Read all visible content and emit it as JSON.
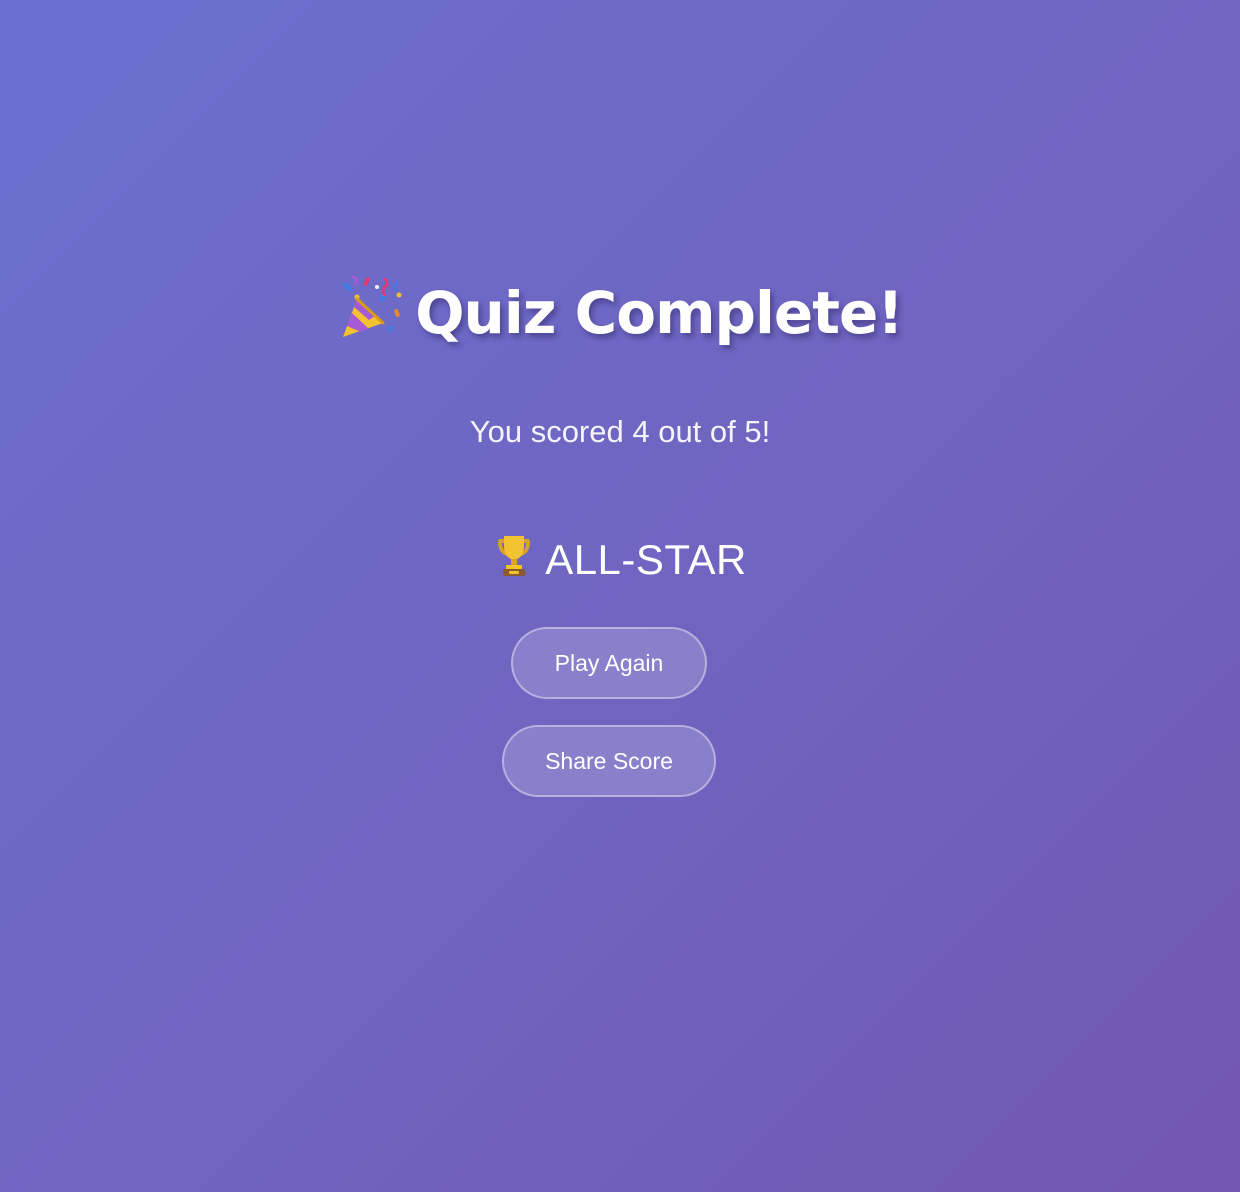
{
  "results": {
    "title": "Quiz Complete!",
    "title_icon": "party-popper-icon",
    "score_text": "You scored 4 out of 5!",
    "score": 4,
    "total": 5,
    "rank_icon": "trophy-icon",
    "rank_label": "ALL-STAR"
  },
  "actions": {
    "play_again_label": "Play Again",
    "share_label": "Share Score"
  },
  "colors": {
    "background_start": "#6b70cf",
    "background_end": "#7257b0",
    "text": "#ffffff"
  }
}
